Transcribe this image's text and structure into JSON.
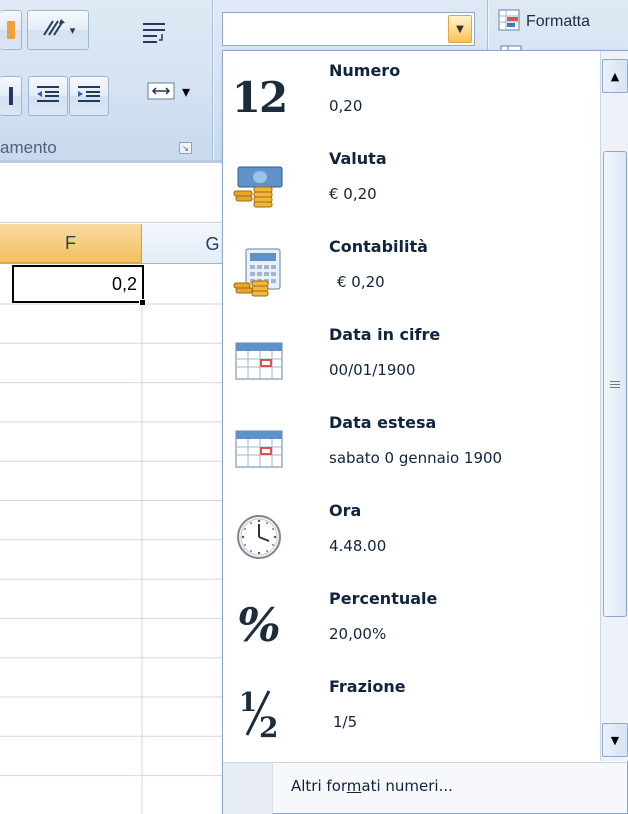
{
  "ribbon": {
    "group_label": "amento",
    "number_format_value": "",
    "conditional_formatting_label": "Formatta"
  },
  "grid": {
    "columns": [
      "F",
      "G"
    ],
    "active_cell_value": "0,2"
  },
  "gallery": {
    "items": [
      {
        "name": "Numero",
        "value": "0,20",
        "icon": "number-12-icon"
      },
      {
        "name": "Valuta",
        "value": "€ 0,20",
        "icon": "currency-icon"
      },
      {
        "name": "Contabilità",
        "value": "€ 0,20",
        "icon": "accounting-icon"
      },
      {
        "name": "Data in cifre",
        "value": "00/01/1900",
        "icon": "short-date-icon"
      },
      {
        "name": "Data estesa",
        "value": "sabato 0 gennaio 1900",
        "icon": "long-date-icon"
      },
      {
        "name": "Ora",
        "value": "4.48.00",
        "icon": "clock-icon"
      },
      {
        "name": "Percentuale",
        "value": "20,00%",
        "icon": "percent-icon"
      },
      {
        "name": "Frazione",
        "value": "1/5",
        "icon": "fraction-icon"
      }
    ],
    "icon_glyphs": {
      "numero": "12",
      "percent": "%"
    },
    "more_formats_label": "Altri formati numeri..."
  },
  "colors": {
    "ribbon_bg": "#d4e2f2",
    "selected_column_header": "#f1c15f",
    "text_dark": "#10243f",
    "border_blue": "#8ea8ca"
  }
}
